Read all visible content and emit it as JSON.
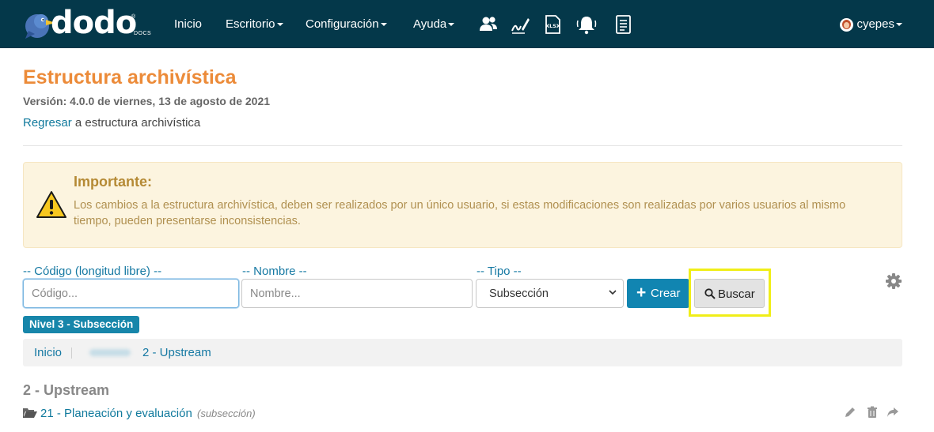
{
  "nav": {
    "logo_text": "dodo",
    "logo_reg": "®",
    "logo_sub": "DOCS",
    "items": [
      {
        "label": "Inicio"
      },
      {
        "label": "Escritorio"
      },
      {
        "label": "Configuración"
      },
      {
        "label": "Ayuda"
      }
    ],
    "icons": [
      "users-icon",
      "signature-icon",
      "xlsx-icon",
      "bell-icon",
      "document-list-icon"
    ],
    "user": "cyepes"
  },
  "header": {
    "title": "Estructura archivística",
    "version": "Versión: 4.0.0 de viernes, 13 de agosto de 2021",
    "back_link": "Regresar",
    "back_suffix": " a estructura archivística"
  },
  "alert": {
    "title": "Importante:",
    "message": "Los cambios a la estructura archivística, deben ser realizados por un único usuario, si estas modificaciones son realizadas por varios usuarios al mismo tiempo, pueden presentarse inconsistencias."
  },
  "search": {
    "code_label": "-- Código (longitud libre) --",
    "code_placeholder": "Código...",
    "name_label": "-- Nombre --",
    "name_placeholder": "Nombre...",
    "type_label": "-- Tipo --",
    "type_value": "Subsección",
    "create_label": "Crear",
    "search_label": "Buscar"
  },
  "level_badge": "Nivel 3 - Subsección",
  "breadcrumb": {
    "home": "Inicio",
    "current": "2 - Upstream"
  },
  "section": {
    "title": "2 - Upstream",
    "items": [
      {
        "name": "21 - Planeación y evaluación",
        "type": "(subsección)"
      }
    ]
  },
  "colors": {
    "navbar": "#04384a",
    "title": "#ec8b39",
    "link": "#1679a3",
    "primary_button": "#1185b1",
    "highlight": "#f0ee18"
  }
}
